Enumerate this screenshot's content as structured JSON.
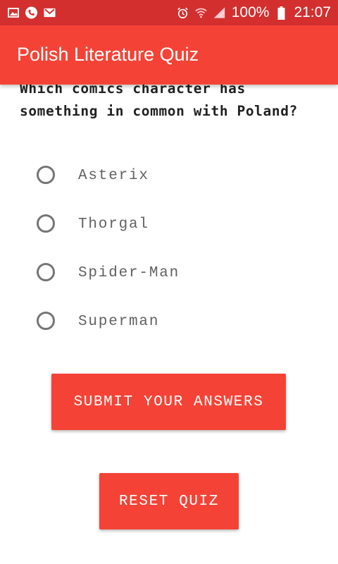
{
  "status_bar": {
    "left_icons": [
      "image-icon",
      "phone-icon",
      "gmail-icon"
    ],
    "right_icons": [
      "alarm-icon",
      "wifi-icon",
      "signal-icon",
      "battery-icon"
    ],
    "battery": "100%",
    "time": "21:07"
  },
  "app_bar": {
    "title": "Polish Literature Quiz"
  },
  "quiz": {
    "question": "Which comics character has something in common with Poland?",
    "options": [
      {
        "label": "Asterix",
        "selected": false
      },
      {
        "label": "Thorgal",
        "selected": false
      },
      {
        "label": "Spider-Man",
        "selected": false
      },
      {
        "label": "Superman",
        "selected": false
      }
    ]
  },
  "buttons": {
    "submit_label": "SUBMIT YOUR ANSWERS",
    "reset_label": "RESET QUIZ"
  },
  "colors": {
    "status_bar": "#d32f2f",
    "primary": "#f44336",
    "radio_border": "#757575",
    "option_text": "#616161"
  }
}
